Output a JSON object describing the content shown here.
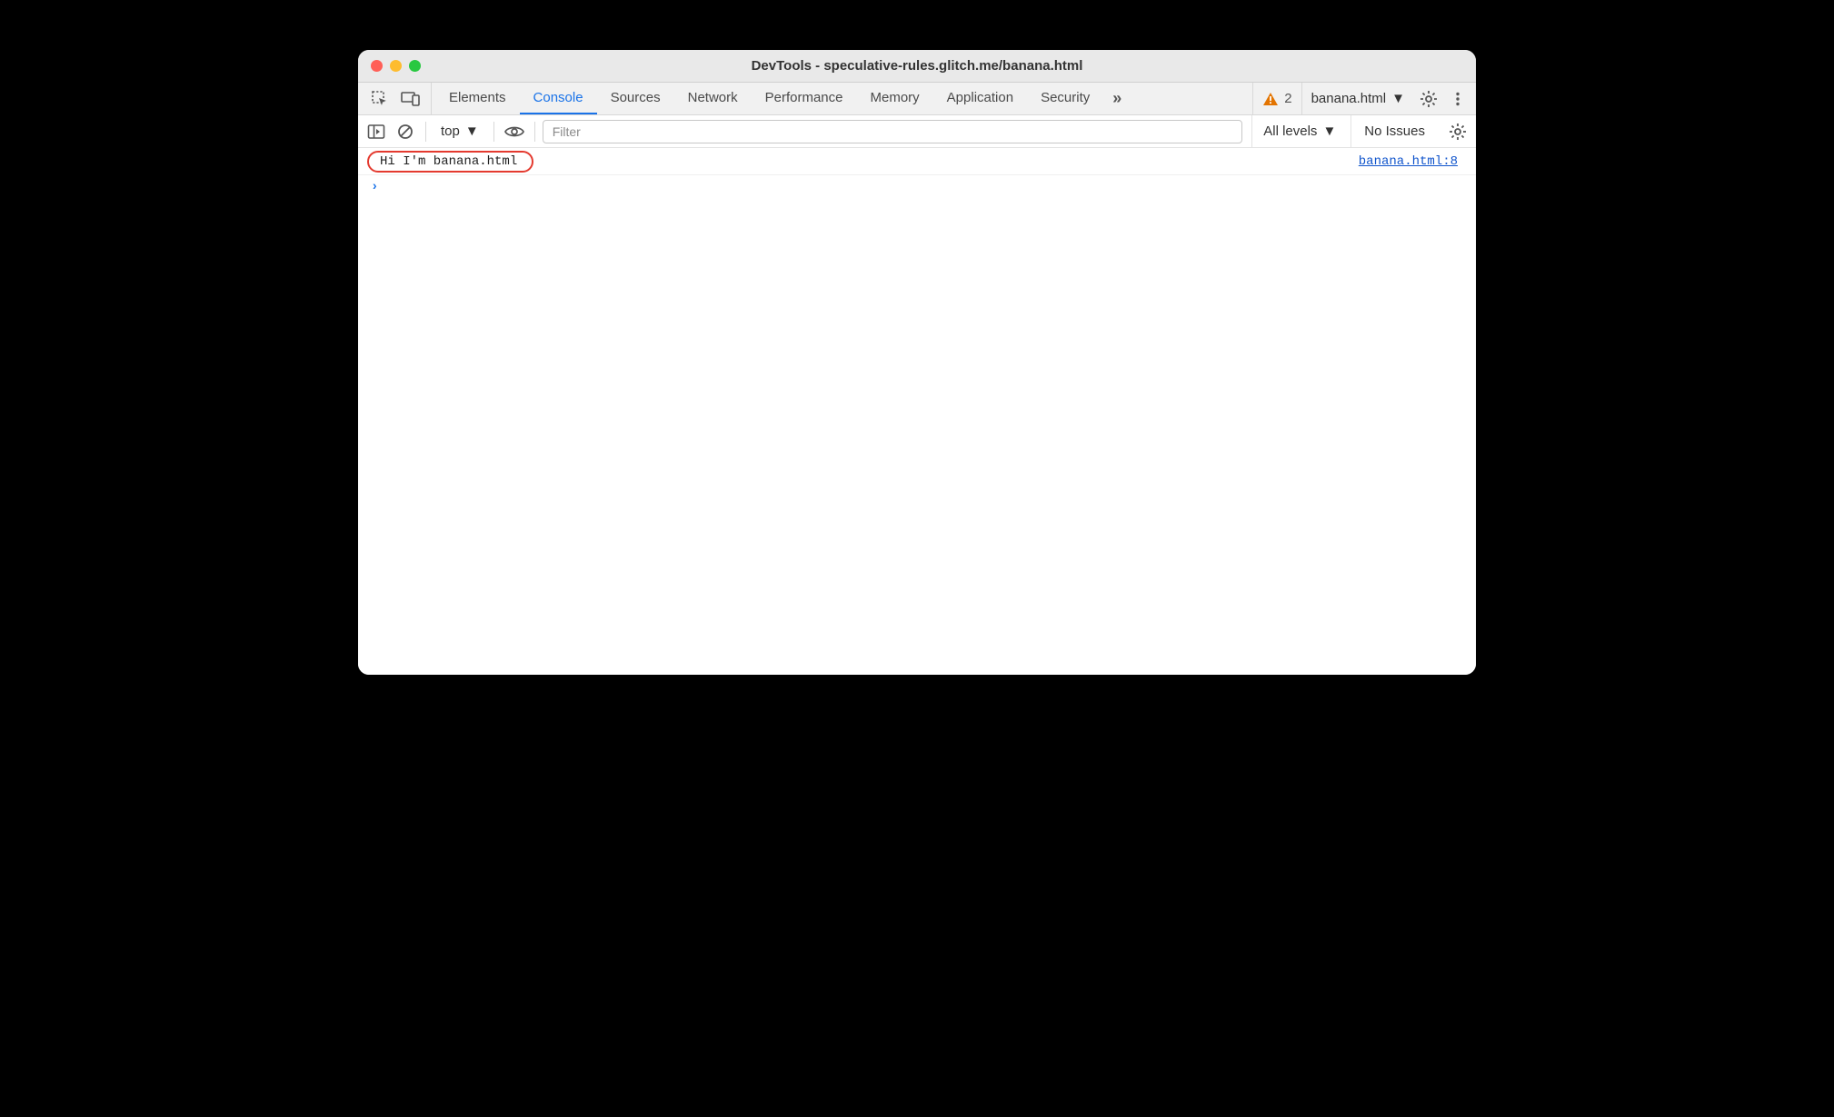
{
  "window": {
    "title": "DevTools - speculative-rules.glitch.me/banana.html"
  },
  "tabs": [
    {
      "label": "Elements",
      "active": false
    },
    {
      "label": "Console",
      "active": true
    },
    {
      "label": "Sources",
      "active": false
    },
    {
      "label": "Network",
      "active": false
    },
    {
      "label": "Performance",
      "active": false
    },
    {
      "label": "Memory",
      "active": false
    },
    {
      "label": "Application",
      "active": false
    },
    {
      "label": "Security",
      "active": false
    }
  ],
  "tabs_overflow_glyph": "»",
  "warnings": {
    "count": "2"
  },
  "target": {
    "label": "banana.html"
  },
  "toolbar": {
    "context_label": "top",
    "filter_placeholder": "Filter",
    "levels_label": "All levels",
    "issues_label": "No Issues"
  },
  "console": {
    "log_message": "Hi I'm banana.html",
    "log_source": "banana.html:8",
    "prompt_glyph": "›"
  }
}
